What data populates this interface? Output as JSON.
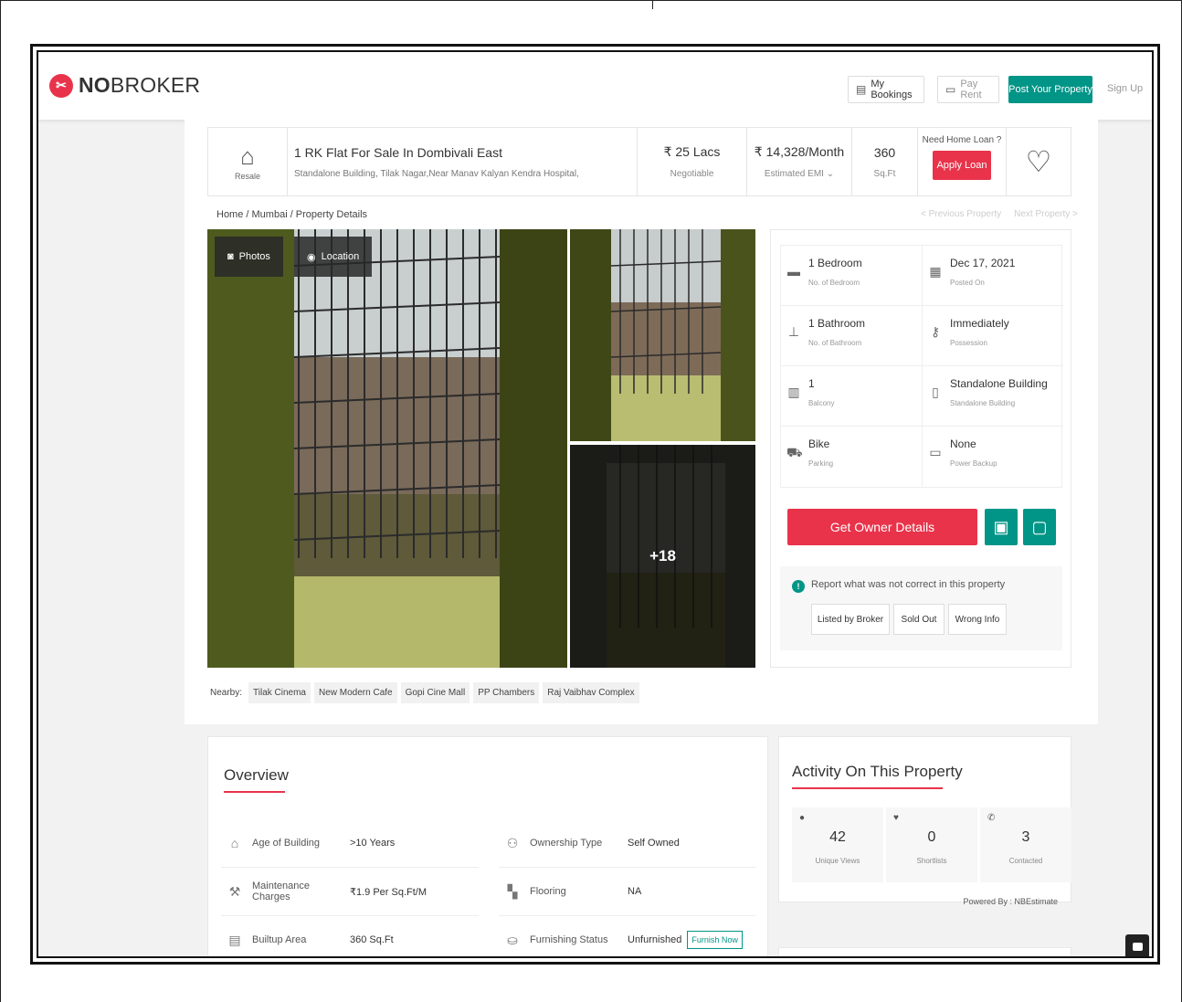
{
  "header": {
    "brand": "NOBROKER",
    "my_bookings": "My Bookings",
    "pay_rent": "Pay Rent",
    "post_property": "Post Your Property",
    "sign_up": "Sign Up"
  },
  "listing": {
    "tag": "Resale",
    "title": "1 RK Flat For Sale In Dombivali East",
    "address": "Standalone Building, Tilak Nagar,Near Manav Kalyan Kendra Hospital,",
    "price": "₹ 25 Lacs",
    "price_note": "Negotiable",
    "emi": "₹ 14,328/Month",
    "emi_note": "Estimated EMI ⌄",
    "area": "360",
    "area_unit": "Sq.Ft",
    "loan_question": "Need Home Loan ?",
    "apply_loan": "Apply Loan"
  },
  "breadcrumb": "Home / Mumbai / Property Details",
  "nav": {
    "prev": "< Previous Property",
    "next": "Next Property >"
  },
  "gallery": {
    "photos": "Photos",
    "location": "Location",
    "more": "+18"
  },
  "nearby": {
    "label": "Nearby:",
    "places": [
      "Tilak Cinema",
      "New Modern Cafe",
      "Gopi Cine Mall",
      "PP Chambers",
      "Raj Vaibhav Complex"
    ]
  },
  "specs": [
    {
      "value": "1 Bedroom",
      "label": "No. of Bedroom",
      "icon": "bed-icon"
    },
    {
      "value": "Dec 17, 2021",
      "label": "Posted On",
      "icon": "calendar-icon"
    },
    {
      "value": "1 Bathroom",
      "label": "No. of Bathroom",
      "icon": "shower-icon"
    },
    {
      "value": "Immediately",
      "label": "Possession",
      "icon": "key-icon"
    },
    {
      "value": "1",
      "label": "Balcony",
      "icon": "balcony-icon"
    },
    {
      "value": "Standalone Building",
      "label": "Standalone Building",
      "icon": "building-icon"
    },
    {
      "value": "Bike",
      "label": "Parking",
      "icon": "car-icon"
    },
    {
      "value": "None",
      "label": "Power Backup",
      "icon": "battery-icon"
    }
  ],
  "actions": {
    "owner_details": "Get Owner Details",
    "report_text": "Report what was not correct in this property",
    "listed_by_broker": "Listed by Broker",
    "sold_out": "Sold Out",
    "wrong_info": "Wrong Info"
  },
  "overview": {
    "title": "Overview",
    "rows": [
      {
        "key": "Age of Building",
        "value": ">10 Years"
      },
      {
        "key": "Ownership Type",
        "value": "Self Owned"
      },
      {
        "key": "Maintenance Charges",
        "value": "₹1.9 Per Sq.Ft/M"
      },
      {
        "key": "Flooring",
        "value": "NA"
      },
      {
        "key": "Builtup Area",
        "value": "360 Sq.Ft"
      },
      {
        "key": "Furnishing Status",
        "value": "Unfurnished"
      }
    ],
    "furnish_now": "Furnish Now"
  },
  "activity": {
    "title": "Activity On This Property",
    "stats": [
      {
        "value": "42",
        "label": "Unique Views"
      },
      {
        "value": "0",
        "label": "Shortlists"
      },
      {
        "value": "3",
        "label": "Contacted"
      }
    ],
    "powered_by": "Powered By : NBEstimate"
  },
  "colors": {
    "brand_red": "#e8334a",
    "brand_teal": "#009587"
  }
}
